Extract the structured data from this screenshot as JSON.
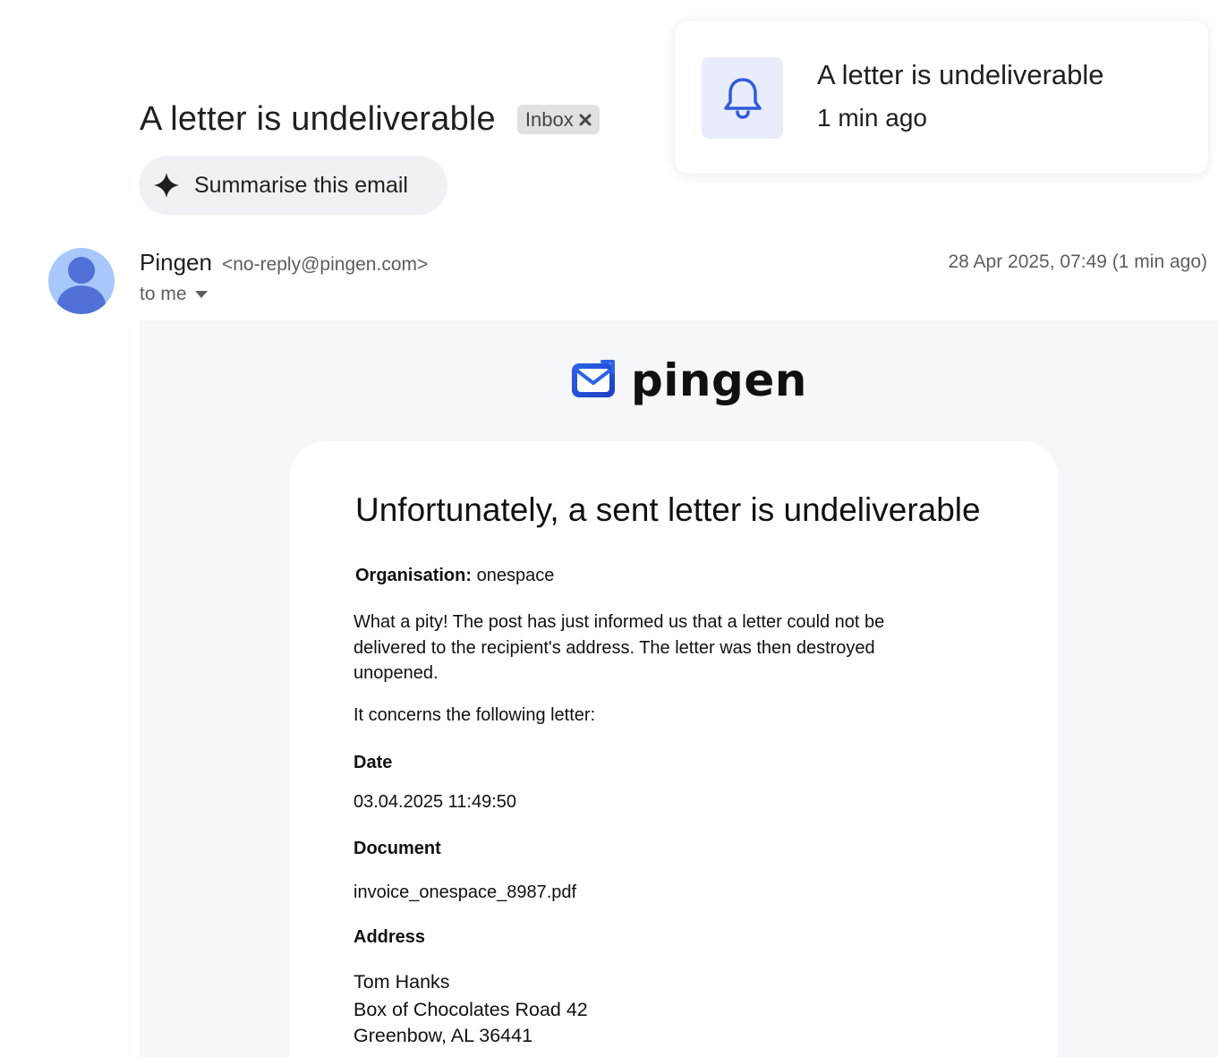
{
  "email": {
    "subject": "A letter is undeliverable",
    "label_chip": "Inbox",
    "summarise_label": "Summarise this email",
    "sender_name": "Pingen",
    "sender_email": "<no-reply@pingen.com>",
    "date": "28 Apr 2025, 07:49 (1 min ago)",
    "recipient": "to me"
  },
  "notification": {
    "title": "A letter is undeliverable",
    "time": "1 min ago",
    "icon": "bell-icon"
  },
  "body": {
    "logo_text": "pingen",
    "heading": "Unfortunately, a sent letter is undeliverable",
    "organisation_label": "Organisation:",
    "organisation_value": "onespace",
    "paragraph": "What a pity! The post has just informed us that a letter could not be delivered to the recipient's address. The letter was then destroyed unopened.",
    "concerns": "It concerns the following letter:",
    "date_label": "Date",
    "date_value": "03.04.2025 11:49:50",
    "document_label": "Document",
    "document_value": "invoice_onespace_8987.pdf",
    "address_label": "Address",
    "address_lines": [
      "Tom Hanks",
      "Box of Chocolates Road 42",
      "Greenbow, AL 36441"
    ]
  },
  "colors": {
    "accent": "#2f5bdc",
    "avatar_bg": "#a8c7fa",
    "avatar_fg": "#5271d8",
    "body_bg": "#f6f7fa",
    "chip_bg": "#e1e1e1"
  }
}
